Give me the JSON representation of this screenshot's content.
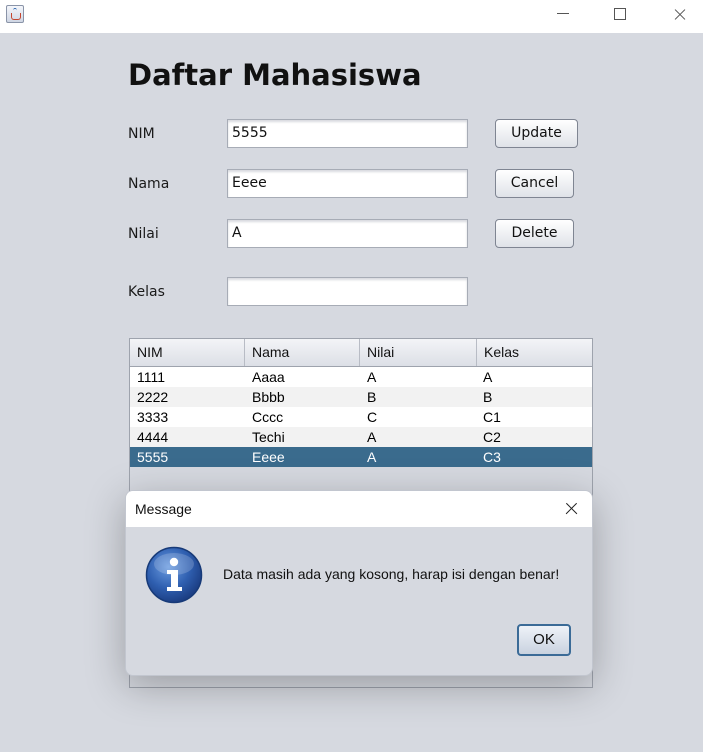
{
  "window": {
    "controls": {
      "minimize": "minimize-icon",
      "maximize": "maximize-icon",
      "close": "close-icon"
    }
  },
  "form": {
    "title": "Daftar Mahasiswa",
    "nim_label": "NIM",
    "nim_value": "5555",
    "nama_label": "Nama",
    "nama_value": "Eeee",
    "nilai_label": "Nilai",
    "nilai_value": "A",
    "kelas_label": "Kelas",
    "kelas_value": ""
  },
  "buttons": {
    "update": "Update",
    "cancel": "Cancel",
    "delete": "Delete"
  },
  "table": {
    "columns": [
      "NIM",
      "Nama",
      "Nilai",
      "Kelas"
    ],
    "rows": [
      [
        "1111",
        "Aaaa",
        "A",
        "A"
      ],
      [
        "2222",
        "Bbbb",
        "B",
        "B"
      ],
      [
        "3333",
        "Cccc",
        "C",
        "C1"
      ],
      [
        "4444",
        "Techi",
        "A",
        "C2"
      ],
      [
        "5555",
        "Eeee",
        "A",
        "C3"
      ]
    ],
    "selected_row": 4
  },
  "dialog": {
    "title": "Message",
    "message": "Data masih ada yang kosong, harap isi dengan benar!",
    "ok_label": "OK",
    "icon": "info-icon"
  },
  "colors": {
    "background": "#d6d9e0",
    "selection": "#3a6b8d",
    "info_icon": "#2f5fb0"
  }
}
